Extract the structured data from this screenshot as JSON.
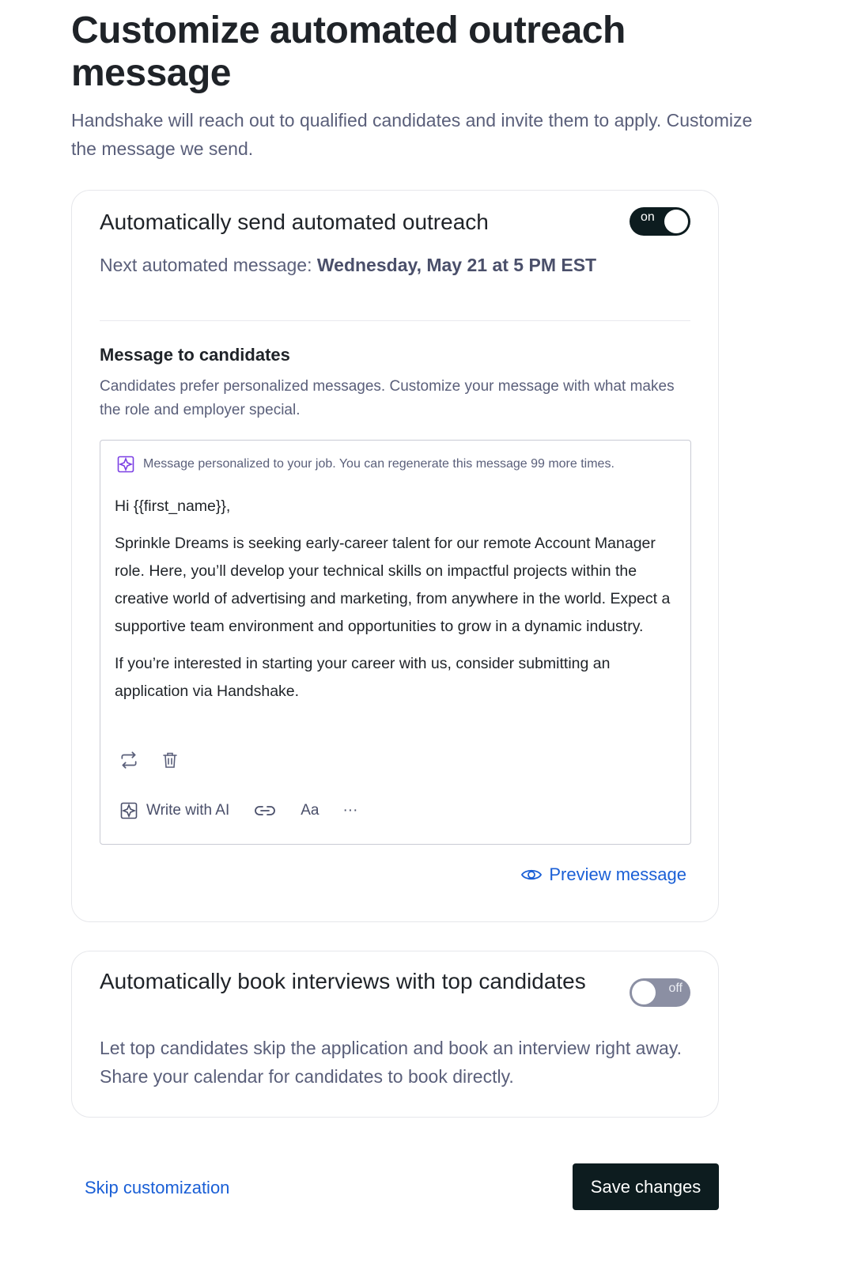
{
  "page": {
    "title": "Customize automated outreach message",
    "subtitle": "Handshake will reach out to qualified candidates and invite them to apply. Customize the message we send."
  },
  "outreach": {
    "heading": "Automatically send automated outreach",
    "toggle_label": "on",
    "toggle_state": true,
    "next_message_prefix": "Next automated message: ",
    "next_message_date": "Wednesday, May 21 at 5 PM EST",
    "section_title": "Message to candidates",
    "section_desc": "Candidates prefer personalized messages. Customize your message with what makes the role and employer special.",
    "ai_note": "Message personalized to your job. You can regenerate this message 99 more times.",
    "message": {
      "greeting": "Hi {{first_name}},",
      "paragraph1": "Sprinkle Dreams is seeking early-career talent for our remote Account Manager role. Here, you’ll develop your technical skills on impactful projects within the creative world of advertising and marketing, from anywhere in the world. Expect a supportive team environment and opportunities to grow in a dynamic industry.",
      "paragraph2": "If you’re interested in starting your career with us, consider submitting an application via Handshake."
    },
    "toolbar": {
      "write_ai": "Write with AI",
      "text_format": "Aa",
      "more": "···"
    },
    "preview_label": "Preview message"
  },
  "interviews": {
    "heading": "Automatically book interviews with top candidates",
    "toggle_label": "off",
    "toggle_state": false,
    "desc": "Let top candidates skip the application and book an interview right away. Share your calendar for candidates to book directly."
  },
  "footer": {
    "skip_label": "Skip customization",
    "save_label": "Save changes"
  },
  "colors": {
    "accent_link": "#1a5fd6",
    "dark_button": "#0d1c1f",
    "muted_text": "#5a5f7a",
    "ai_icon": "#7b3fe4"
  }
}
